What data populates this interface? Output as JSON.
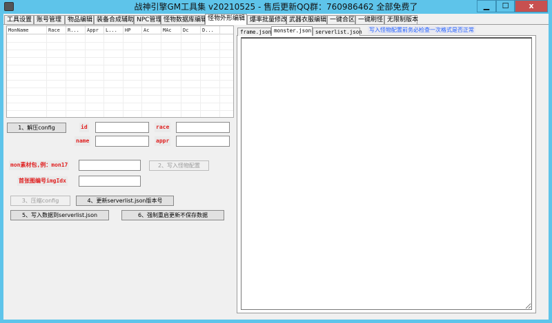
{
  "window": {
    "title": "战神引擎GM工具集 v20210525 - 售后更新QQ群：760986462  全部免费了",
    "minimize": "▁",
    "maximize": "☐",
    "close": "x"
  },
  "tabs": [
    {
      "label": "工具设置"
    },
    {
      "label": "账号管理"
    },
    {
      "label": "物品编辑"
    },
    {
      "label": "装备合成辅助"
    },
    {
      "label": "NPC管理"
    },
    {
      "label": "怪物数据库编辑"
    },
    {
      "label": "怪物外形编辑",
      "active": true
    },
    {
      "label": "爆率批量修改"
    },
    {
      "label": "武器衣服编辑"
    },
    {
      "label": "一键合区"
    },
    {
      "label": "一键刷怪"
    },
    {
      "label": "无限制版本"
    }
  ],
  "grid": {
    "columns": [
      "MonName",
      "Race",
      "R...",
      "Appr",
      "L...",
      "HP",
      "Ac",
      "MAc",
      "Dc",
      "D...",
      ""
    ],
    "rows": []
  },
  "form": {
    "unpack_button": "1、解压config",
    "id_label": "id",
    "id_value": "",
    "race_label": "race",
    "race_value": "",
    "name_label": "name",
    "name_value": "",
    "appr_label": "appr",
    "appr_value": "",
    "mon_label": "mon素材包,例：mon17",
    "mon_value": "",
    "imgidx_label": "首张图编号imgIdx",
    "imgidx_value": "",
    "write_monster_button": "2、写入怪物配置",
    "compress_button": "3、压缩config",
    "update_version_button": "4、更新serverlist.json版本号",
    "write_serverlist_button": "5、写入数据到serverlist.json",
    "force_restart_button": "6、强制重启更新不保存数据"
  },
  "right": {
    "tabs": [
      {
        "label": "frame.json"
      },
      {
        "label": "monster.json",
        "active": true
      },
      {
        "label": "serverlist.json"
      }
    ],
    "hint": "写入怪物配置前务必检查一次格式是否正常",
    "editor_content": ""
  }
}
